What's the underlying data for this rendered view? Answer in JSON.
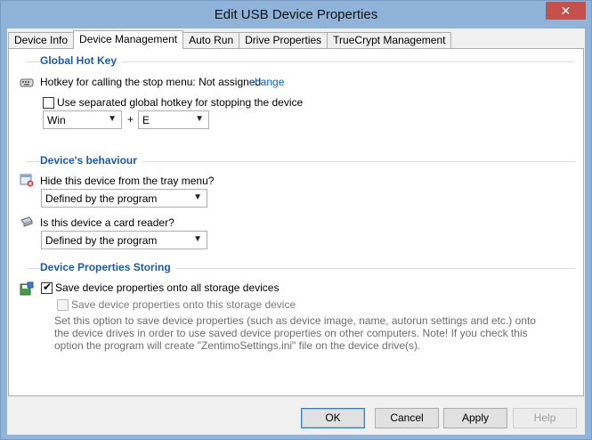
{
  "window": {
    "title": "Edit USB Device Properties",
    "close_glyph": "✕"
  },
  "tabs": [
    {
      "label": "Device Info",
      "active": false
    },
    {
      "label": "Device Management",
      "active": true
    },
    {
      "label": "Auto Run",
      "active": false
    },
    {
      "label": "Drive Properties",
      "active": false
    },
    {
      "label": "TrueCrypt Management",
      "active": false
    }
  ],
  "hotkey": {
    "section_title": "Global Hot Key",
    "stop_menu_label": "Hotkey for calling the stop menu: Not assigned",
    "change_link": "change",
    "separated_label": "Use separated global hotkey for stopping the device",
    "separated_checked": false,
    "modifier_value": "Win",
    "plus": "+",
    "key_value": "E"
  },
  "behaviour": {
    "section_title": "Device's behaviour",
    "hide_label": "Hide this device from the tray menu?",
    "hide_value": "Defined by the program",
    "card_reader_label": "Is this device a card reader?",
    "card_reader_value": "Defined by the program"
  },
  "storing": {
    "section_title": "Device Properties Storing",
    "save_all_label": "Save device properties onto all storage devices",
    "save_all_checked": true,
    "save_this_label": "Save device properties onto this storage device",
    "save_this_checked": false,
    "description": "Set this option to save device properties (such as device image, name, autorun settings and etc.) onto the device drives in order to use saved device properties on other computers. Note! If you check this option the program will create \"ZentimoSettings.ini\" file on the device drive(s)."
  },
  "buttons": {
    "ok": "OK",
    "cancel": "Cancel",
    "apply": "Apply",
    "help": "Help"
  },
  "colors": {
    "section_title": "#1e5aa8",
    "link": "#0066cc",
    "titlebar": "#8fb3d9",
    "close": "#c7504a"
  },
  "icons": {
    "hotkey": "keyboard-icon",
    "hide": "window-hide-icon",
    "card_reader": "card-reader-icon",
    "storing": "save-device-icon"
  }
}
